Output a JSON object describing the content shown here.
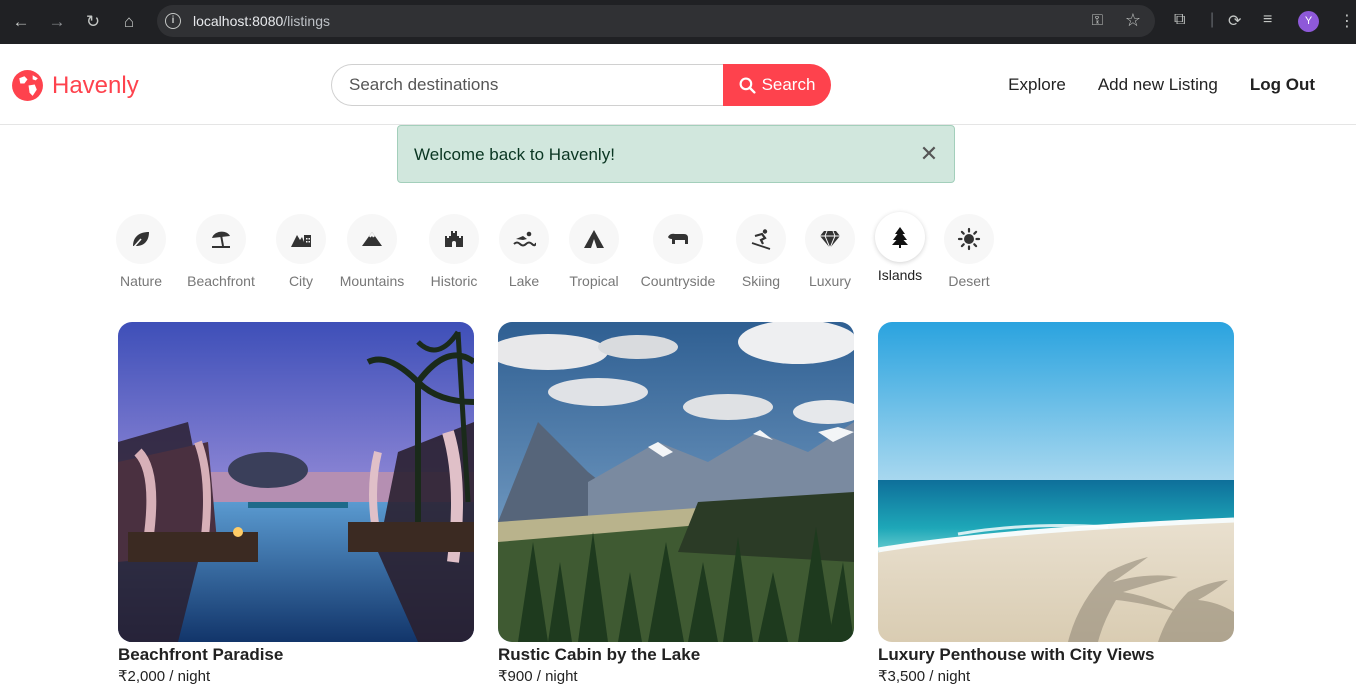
{
  "browser": {
    "url_host": "localhost:8080",
    "url_path": "/listings",
    "profile_initial": "Y"
  },
  "navbar": {
    "brand": "Havenly",
    "search_placeholder": "Search destinations",
    "search_button": "Search",
    "links": [
      "Explore",
      "Add new Listing",
      "Log Out"
    ]
  },
  "flash": {
    "message": "Welcome back to Havenly!"
  },
  "filters": [
    {
      "label": "Nature",
      "icon": "leaf-icon"
    },
    {
      "label": "Beachfront",
      "icon": "umbrella-beach-icon"
    },
    {
      "label": "City",
      "icon": "city-icon"
    },
    {
      "label": "Mountains",
      "icon": "mountain-icon"
    },
    {
      "label": "Historic",
      "icon": "castle-icon"
    },
    {
      "label": "Lake",
      "icon": "swimmer-icon"
    },
    {
      "label": "Tropical",
      "icon": "tent-icon"
    },
    {
      "label": "Countryside",
      "icon": "cow-icon"
    },
    {
      "label": "Skiing",
      "icon": "skier-icon"
    },
    {
      "label": "Luxury",
      "icon": "gem-icon"
    },
    {
      "label": "Islands",
      "icon": "tree-icon",
      "active": true
    },
    {
      "label": "Desert",
      "icon": "sun-icon"
    }
  ],
  "listings": [
    {
      "title": "Beachfront Paradise",
      "price": "₹2,000 / night"
    },
    {
      "title": "Rustic Cabin by the Lake",
      "price": "₹900 / night"
    },
    {
      "title": "Luxury Penthouse with City Views",
      "price": "₹3,500 / night"
    }
  ],
  "colors": {
    "brand": "#fe424d",
    "flash_bg": "#d1e7dd"
  }
}
